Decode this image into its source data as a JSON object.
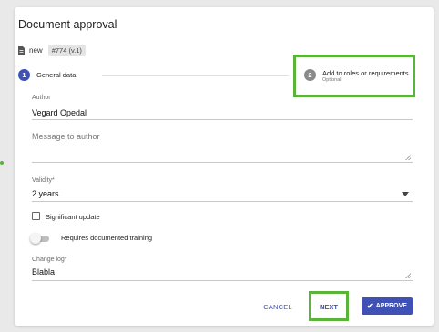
{
  "dialog": {
    "title": "Document approval",
    "doc_status": "new",
    "doc_badge": "#774 (v.1)"
  },
  "stepper": {
    "steps": [
      {
        "number": "1",
        "label": "General data"
      },
      {
        "number": "2",
        "label": "Add to roles or requirements",
        "sublabel": "Optional"
      }
    ]
  },
  "form": {
    "author": {
      "label": "Author",
      "value": "Vegard Opedal"
    },
    "message": {
      "placeholder": "Message to author"
    },
    "validity": {
      "label": "Validity*",
      "value": "2 years"
    },
    "significant_update": {
      "label": "Significant update",
      "checked": false
    },
    "documented_training": {
      "label": "Requires documented training",
      "on": false
    },
    "change_log": {
      "label": "Change log*",
      "value": "Blabla"
    }
  },
  "actions": {
    "cancel": "CANCEL",
    "next": "NEXT",
    "approve": "APPROVE"
  },
  "colors": {
    "accent": "#3f51b5",
    "highlight": "#5ab43a"
  }
}
